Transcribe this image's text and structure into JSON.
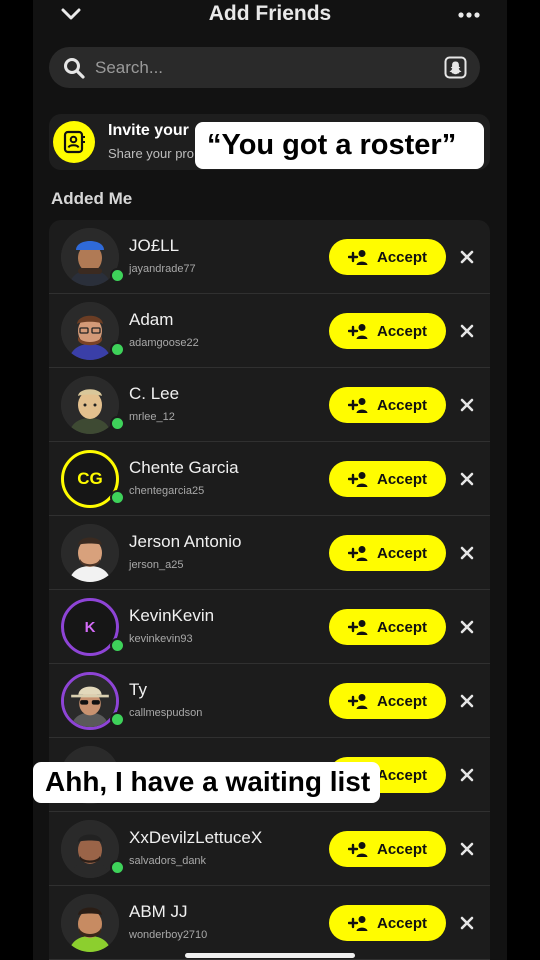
{
  "header": {
    "title": "Add Friends"
  },
  "search": {
    "placeholder": "Search..."
  },
  "invite": {
    "title": "Invite your",
    "subtitle": "Share your pro"
  },
  "section": {
    "title": "Added Me"
  },
  "accept_label": "Accept",
  "rows": [
    {
      "name": "JO£LL",
      "username": "jayandrade77"
    },
    {
      "name": "Adam",
      "username": "adamgoose22"
    },
    {
      "name": "C. Lee",
      "username": "mrlee_12"
    },
    {
      "name": "Chente Garcia",
      "username": "chentegarcia25",
      "initials": "CG"
    },
    {
      "name": "Jerson Antonio",
      "username": "jerson_a25"
    },
    {
      "name": "KevinKevin",
      "username": "kevinkevin93",
      "initials": "K"
    },
    {
      "name": "Ty",
      "username": "callmespudson"
    },
    {
      "name": "",
      "username": ""
    },
    {
      "name": "XxDevilzLettuceX",
      "username": "salvadors_dank"
    },
    {
      "name": "ABM JJ",
      "username": "wonderboy2710"
    }
  ],
  "captions": {
    "top": "“You got a roster”",
    "middle": "Ahh, I have a waiting list"
  },
  "colors": {
    "accent": "#fffc00",
    "online": "#3ed25a",
    "background": "#121212"
  }
}
